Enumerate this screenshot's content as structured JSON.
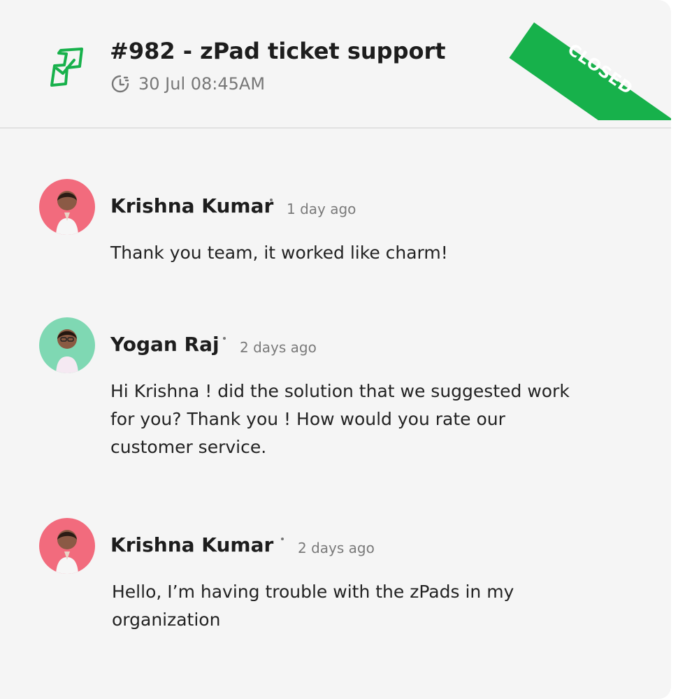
{
  "ticket": {
    "title": "#982 - zPad ticket support",
    "datetime": "30 Jul 08:45AM",
    "status": "CLOSED",
    "status_color": "#17b14b",
    "icon": "ticket-icon",
    "clock_icon": "clock-icon"
  },
  "messages": [
    {
      "author": "Krishna Kumar",
      "time": "1 day ago",
      "text": "Thank you team, it worked like charm!",
      "avatar_color": "#f26b7d"
    },
    {
      "author": "Yogan Raj",
      "time": "2 days ago",
      "text": "Hi Krishna ! did the solution that we suggested work for you? Thank you ! How would you rate our customer service.",
      "avatar_color": "#7fd8b3"
    },
    {
      "author": "Krishna Kumar",
      "time": "2 days ago",
      "text": "Hello, I’m having trouble with the zPads in my organization",
      "avatar_color": "#f26b7d"
    }
  ]
}
